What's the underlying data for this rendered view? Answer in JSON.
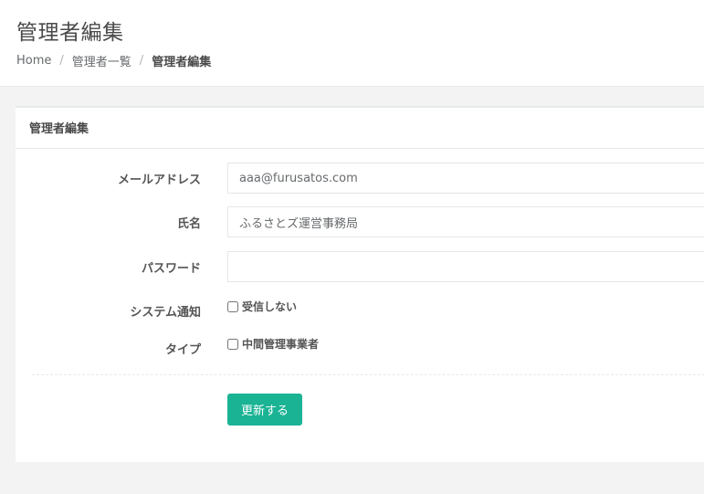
{
  "header": {
    "title": "管理者編集",
    "breadcrumb": {
      "home": "Home",
      "list": "管理者一覧",
      "current": "管理者編集",
      "separator": "/"
    }
  },
  "form": {
    "panel_title": "管理者編集",
    "email": {
      "label": "メールアドレス",
      "value": "aaa@furusatos.com"
    },
    "name": {
      "label": "氏名",
      "value": "ふるさとズ運営事務局"
    },
    "password": {
      "label": "パスワード",
      "value": ""
    },
    "notification": {
      "label": "システム通知",
      "option_label": "受信しない",
      "checked": false
    },
    "type": {
      "label": "タイプ",
      "option_label": "中間管理事業者",
      "checked": false
    },
    "submit_label": "更新する"
  },
  "colors": {
    "accent": "#1ab394"
  }
}
